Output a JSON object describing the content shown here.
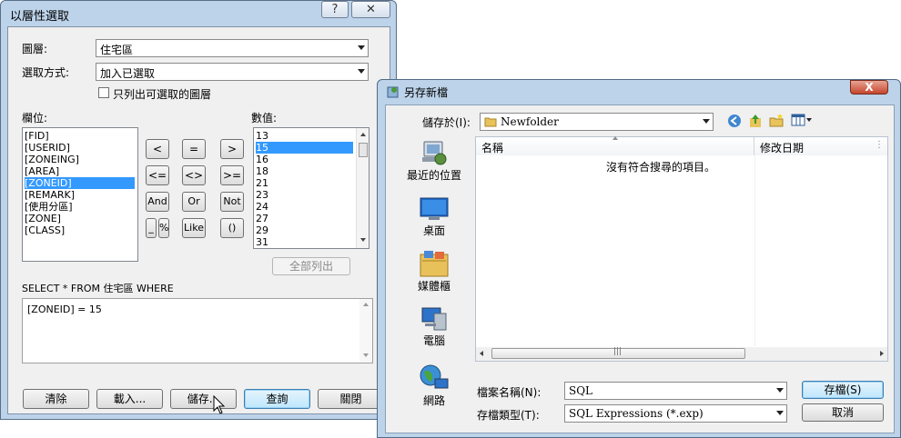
{
  "select_dialog": {
    "title": "以層性選取",
    "help_button": "?",
    "close_button": "✕",
    "layer_label": "圖層:",
    "layer_value": "住宅區",
    "method_label": "選取方式:",
    "method_value": "加入已選取",
    "only_selectable_label": "只列出可選取的圖層",
    "fields_label": "欄位:",
    "fields": [
      "[FID]",
      "[USERID]",
      "[ZONEING]",
      "[AREA]",
      "[ZONEID]",
      "[REMARK]",
      "[使用分區]",
      "[ZONE]",
      "[CLASS]"
    ],
    "selected_field_index": 4,
    "values_label": "數值:",
    "values": [
      "13",
      "15",
      "16",
      "18",
      "21",
      "23",
      "24",
      "27",
      "29",
      "31"
    ],
    "selected_value_index": 1,
    "operators": [
      "<",
      "=",
      ">",
      "<=",
      "<>",
      ">=",
      "And",
      "Or",
      "Not",
      "_",
      "%",
      "Like",
      "()"
    ],
    "list_all_button": "全部列出",
    "query_prefix": "SELECT * FROM 住宅區 WHERE",
    "expression": "[ZONEID] = 15",
    "buttons": {
      "clear": "清除",
      "load": "載入...",
      "save": "儲存...",
      "query": "查詢",
      "close": "關閉"
    }
  },
  "save_dialog": {
    "title": "另存新檔",
    "close_button": "X",
    "save_in_label": "儲存於(I):",
    "save_in_value": "Newfolder",
    "nav_items": [
      {
        "label": "最近的位置",
        "icon": "recent-places-icon"
      },
      {
        "label": "桌面",
        "icon": "desktop-icon"
      },
      {
        "label": "媒體櫃",
        "icon": "libraries-icon"
      },
      {
        "label": "電腦",
        "icon": "computer-icon"
      },
      {
        "label": "網路",
        "icon": "network-icon"
      }
    ],
    "columns": [
      "名稱",
      "修改日期"
    ],
    "empty_message": "沒有符合搜尋的項目。",
    "filename_label": "檔案名稱(N):",
    "filename_value": "SQL",
    "filetype_label": "存檔類型(T):",
    "filetype_value": "SQL Expressions (*.exp)",
    "buttons": {
      "save": "存檔(S)",
      "cancel": "取消"
    }
  }
}
